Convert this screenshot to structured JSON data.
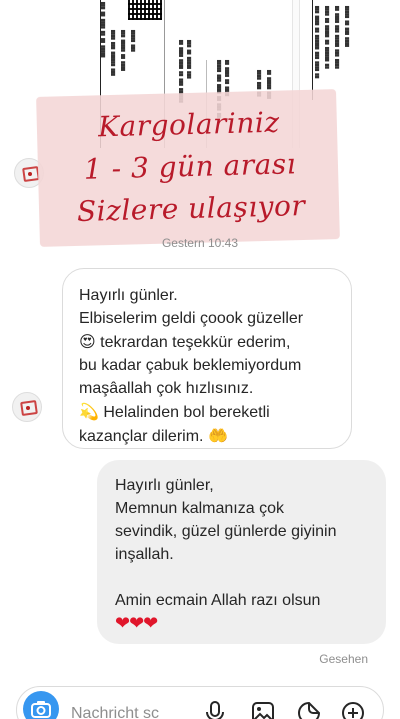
{
  "banner": {
    "line1": "Kargolariniz",
    "line2": "1 - 3 gün arası",
    "line3": "Sizlere ulaşıyor"
  },
  "thread": {
    "timestamp": "Gestern 10:43",
    "incoming": {
      "lines": [
        "Hayırlı günler.",
        "Elbiselerim geldi çoook güzeller",
        "tekrardan teşekkür ederim,",
        "bu kadar çabuk beklemiyordum",
        "maşâallah çok hızlısınız.",
        "Helalinden bol bereketli",
        "kazançlar dilerim."
      ],
      "emoji_heart_eyes": "😍",
      "emoji_dizzy": "💫",
      "emoji_hands": "🤲"
    },
    "outgoing": {
      "lines": [
        "Hayırlı günler,",
        "Memnun kalmanıza çok",
        "sevindik, güzel günlerde giyinin",
        "inşallah.",
        "Amin ecmain Allah razı olsun"
      ],
      "hearts": "❤❤❤"
    },
    "seen": "Gesehen"
  },
  "composer": {
    "placeholder": "Nachricht sc",
    "icons": [
      "camera-icon",
      "microphone-icon",
      "gallery-icon",
      "sticker-icon",
      "plus-icon"
    ]
  },
  "colors": {
    "accent": "#3797f0",
    "banner_bg": "#f4d6d6",
    "banner_text": "#b81a2a",
    "bubble_out": "#efefef"
  }
}
